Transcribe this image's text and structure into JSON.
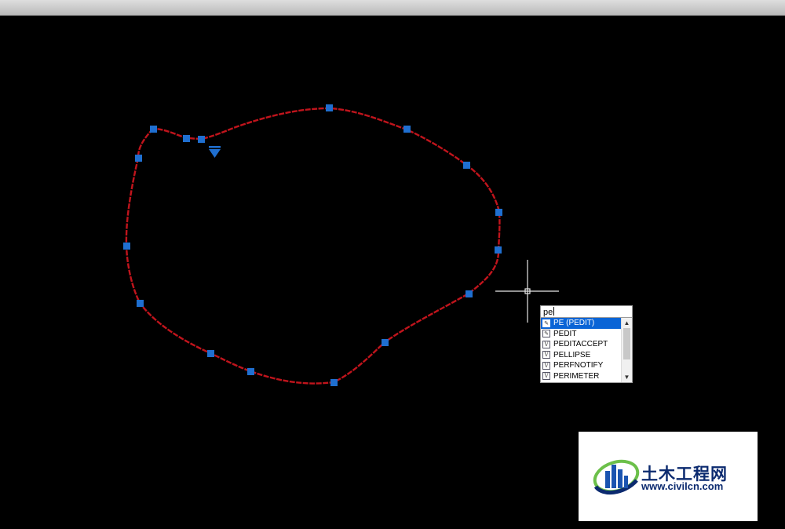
{
  "command_input": {
    "value": "pe"
  },
  "autocomplete": {
    "items": [
      {
        "label": "PE (PEDIT)",
        "icon": "pen-icon",
        "selected": true
      },
      {
        "label": "PEDIT",
        "icon": "pen-icon",
        "selected": false
      },
      {
        "label": "PEDITACCEPT",
        "icon": "variable-icon",
        "selected": false
      },
      {
        "label": "PELLIPSE",
        "icon": "variable-icon",
        "selected": false
      },
      {
        "label": "PERFNOTIFY",
        "icon": "variable-icon",
        "selected": false
      },
      {
        "label": "PERIMETER",
        "icon": "variable-icon",
        "selected": false
      }
    ]
  },
  "watermark": {
    "name_cn": "土木工程网",
    "url": "www.civilcn.com"
  },
  "colors": {
    "curve": "#c0141c",
    "grip": "#1f6fd0",
    "background": "#000000",
    "selection": "#0a64d6"
  }
}
